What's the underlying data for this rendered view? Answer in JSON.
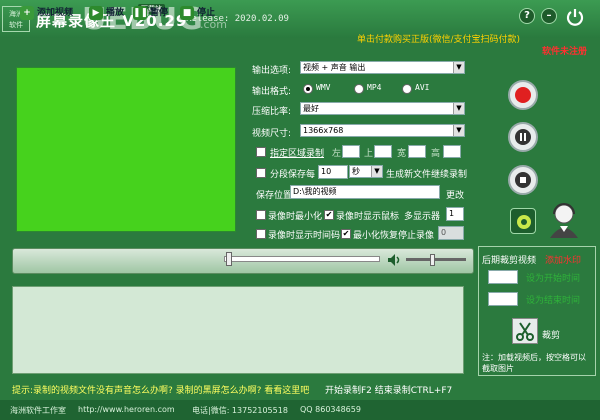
{
  "title": {
    "logo_text": "海洲\n软件",
    "app_name": "屏幕录像王 V20.29",
    "download_tag": "下载站",
    "release": "Release: 2020.02.09",
    "watermark": "UEBUG",
    "watermark_com": ".com",
    "help": "?",
    "minimize": "–",
    "buy_link": "单击付款购买正版(微信/支付宝扫码付款)",
    "unregistered": "软件未注册"
  },
  "settings": {
    "output_option_label": "输出选项:",
    "output_option_value": "视频 + 声音 输出",
    "output_format_label": "输出格式:",
    "formats": [
      "WMV",
      "MP4",
      "AVI"
    ],
    "selected_format": "WMV",
    "compression_label": "压缩比率:",
    "compression_value": "最好",
    "video_size_label": "视频尺寸:",
    "video_size_value": "1366x768",
    "region_record_label": "指定区域录制",
    "region_left": "左",
    "region_top": "上",
    "region_width": "宽",
    "region_height": "高",
    "segment_save_label": "分段保存",
    "every_label": "每",
    "segment_value": "10",
    "segment_unit": "秒",
    "segment_suffix": "生成新文件继续录制",
    "save_location_label": "保存位置",
    "save_location_value": "D:\\我的视频",
    "change_button": "更改",
    "minimize_on_record": "录像时最小化",
    "show_cursor": "录像时显示鼠标",
    "multi_monitor": "多显示器",
    "monitor_value": "1",
    "show_timecode": "录像时显示时间码",
    "minimize_restore_stop": "最小化恢复停止录像",
    "timecode_value": "0"
  },
  "toolbar": {
    "add_video": "添加视频",
    "play": "播放",
    "pause": "暂停",
    "stop": "停止"
  },
  "post_panel": {
    "title": "后期裁剪视频",
    "add_watermark": "添加水印",
    "set_start": "设为开始时间",
    "set_end": "设为结束时间",
    "crop": "裁剪",
    "note": "注：加载视频后，按空格可以截取图片"
  },
  "tip": "提示:录制的视频文件没有声音怎么办啊? 录制的黑屏怎么办啊? 看看这里吧",
  "shortcuts": "开始录制F2   结束录制CTRL+F7",
  "status": {
    "company": "海洲软件工作室",
    "url": "http://www.heroren.com",
    "phone": "电话|微信: 13752105518",
    "qq": "QQ 860348659"
  },
  "colors": {
    "background": "#2b7a3e",
    "preview": "#46d21d",
    "record_red": "#e02020",
    "warning_red": "#ff3030",
    "buy_yellow": "#ffd200"
  }
}
